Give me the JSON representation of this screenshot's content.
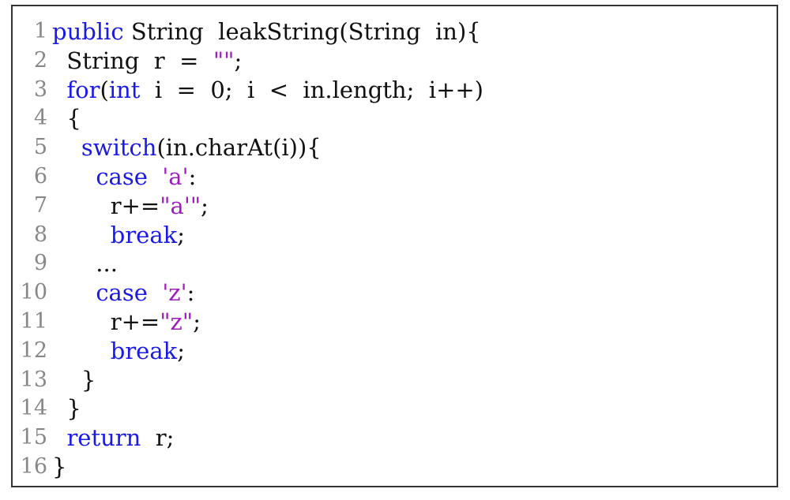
{
  "colors": {
    "keyword": "#1a1ae6",
    "string": "#a01bc0",
    "text": "#111111",
    "line_number": "#888888",
    "border": "#333333",
    "background": "#ffffff"
  },
  "code": {
    "lines": [
      {
        "number": "1",
        "tokens": [
          {
            "type": "kw",
            "text": "public"
          },
          {
            "type": "plain",
            "text": " String  leakString(String  in){"
          }
        ]
      },
      {
        "number": "2",
        "tokens": [
          {
            "type": "plain",
            "text": "  String  r  =  "
          },
          {
            "type": "str",
            "text": "\"\""
          },
          {
            "type": "plain",
            "text": ";"
          }
        ]
      },
      {
        "number": "3",
        "tokens": [
          {
            "type": "plain",
            "text": "  "
          },
          {
            "type": "kw",
            "text": "for"
          },
          {
            "type": "plain",
            "text": "("
          },
          {
            "type": "kw",
            "text": "int"
          },
          {
            "type": "plain",
            "text": "  i  =  0;  i  <  in.length;  i++)"
          }
        ]
      },
      {
        "number": "4",
        "tokens": [
          {
            "type": "plain",
            "text": "  {"
          }
        ]
      },
      {
        "number": "5",
        "tokens": [
          {
            "type": "plain",
            "text": "    "
          },
          {
            "type": "kw",
            "text": "switch"
          },
          {
            "type": "plain",
            "text": "(in.charAt(i)){"
          }
        ]
      },
      {
        "number": "6",
        "tokens": [
          {
            "type": "plain",
            "text": "      "
          },
          {
            "type": "kw",
            "text": "case"
          },
          {
            "type": "plain",
            "text": "  "
          },
          {
            "type": "str",
            "text": "'a'"
          },
          {
            "type": "plain",
            "text": ":"
          }
        ]
      },
      {
        "number": "7",
        "tokens": [
          {
            "type": "plain",
            "text": "        r+="
          },
          {
            "type": "str",
            "text": "\"a'\""
          },
          {
            "type": "plain",
            "text": ";"
          }
        ]
      },
      {
        "number": "8",
        "tokens": [
          {
            "type": "plain",
            "text": "        "
          },
          {
            "type": "kw",
            "text": "break"
          },
          {
            "type": "plain",
            "text": ";"
          }
        ]
      },
      {
        "number": "9",
        "tokens": [
          {
            "type": "plain",
            "text": "      ..."
          }
        ]
      },
      {
        "number": "10",
        "tokens": [
          {
            "type": "plain",
            "text": "      "
          },
          {
            "type": "kw",
            "text": "case"
          },
          {
            "type": "plain",
            "text": "  "
          },
          {
            "type": "str",
            "text": "'z'"
          },
          {
            "type": "plain",
            "text": ":"
          }
        ]
      },
      {
        "number": "11",
        "tokens": [
          {
            "type": "plain",
            "text": "        r+="
          },
          {
            "type": "str",
            "text": "\"z\""
          },
          {
            "type": "plain",
            "text": ";"
          }
        ]
      },
      {
        "number": "12",
        "tokens": [
          {
            "type": "plain",
            "text": "        "
          },
          {
            "type": "kw",
            "text": "break"
          },
          {
            "type": "plain",
            "text": ";"
          }
        ]
      },
      {
        "number": "13",
        "tokens": [
          {
            "type": "plain",
            "text": "    }"
          }
        ]
      },
      {
        "number": "14",
        "tokens": [
          {
            "type": "plain",
            "text": "  }"
          }
        ]
      },
      {
        "number": "15",
        "tokens": [
          {
            "type": "plain",
            "text": "  "
          },
          {
            "type": "kw",
            "text": "return"
          },
          {
            "type": "plain",
            "text": "  r;"
          }
        ]
      },
      {
        "number": "16",
        "tokens": [
          {
            "type": "plain",
            "text": "}"
          }
        ]
      }
    ]
  }
}
